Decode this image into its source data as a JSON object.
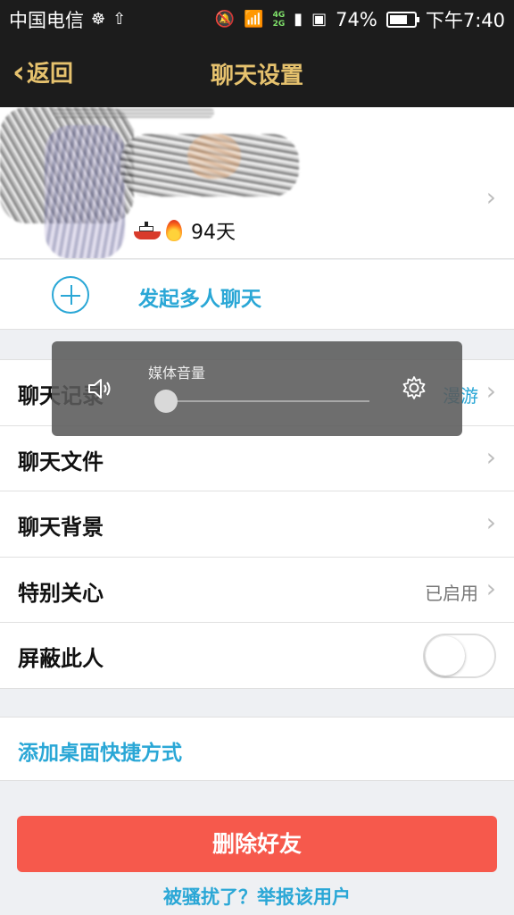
{
  "status_bar": {
    "carrier": "中国电信",
    "network": "4G\n2G",
    "battery_text": "74%",
    "battery_level": 0.74,
    "time": "下午7:40"
  },
  "nav": {
    "back_label": "返回",
    "title": "聊天设置"
  },
  "profile": {
    "days": "94天"
  },
  "group_chat": {
    "label": "发起多人聊天"
  },
  "settings": [
    {
      "label": "聊天记录",
      "value": "漫游"
    },
    {
      "label": "聊天文件"
    },
    {
      "label": "聊天背景"
    },
    {
      "label": "特别关心",
      "value": "已启用"
    },
    {
      "label": "屏蔽此人",
      "toggle": false
    }
  ],
  "shortcut": {
    "label": "添加桌面快捷方式"
  },
  "delete_button": {
    "label": "删除好友"
  },
  "report": {
    "label": "被骚扰了？举报该用户"
  },
  "volume_overlay": {
    "title": "媒体音量",
    "level": 0.04
  },
  "colors": {
    "accent_gold": "#e6c26e",
    "link_blue": "#2aa7d6",
    "danger": "#f6594c"
  }
}
